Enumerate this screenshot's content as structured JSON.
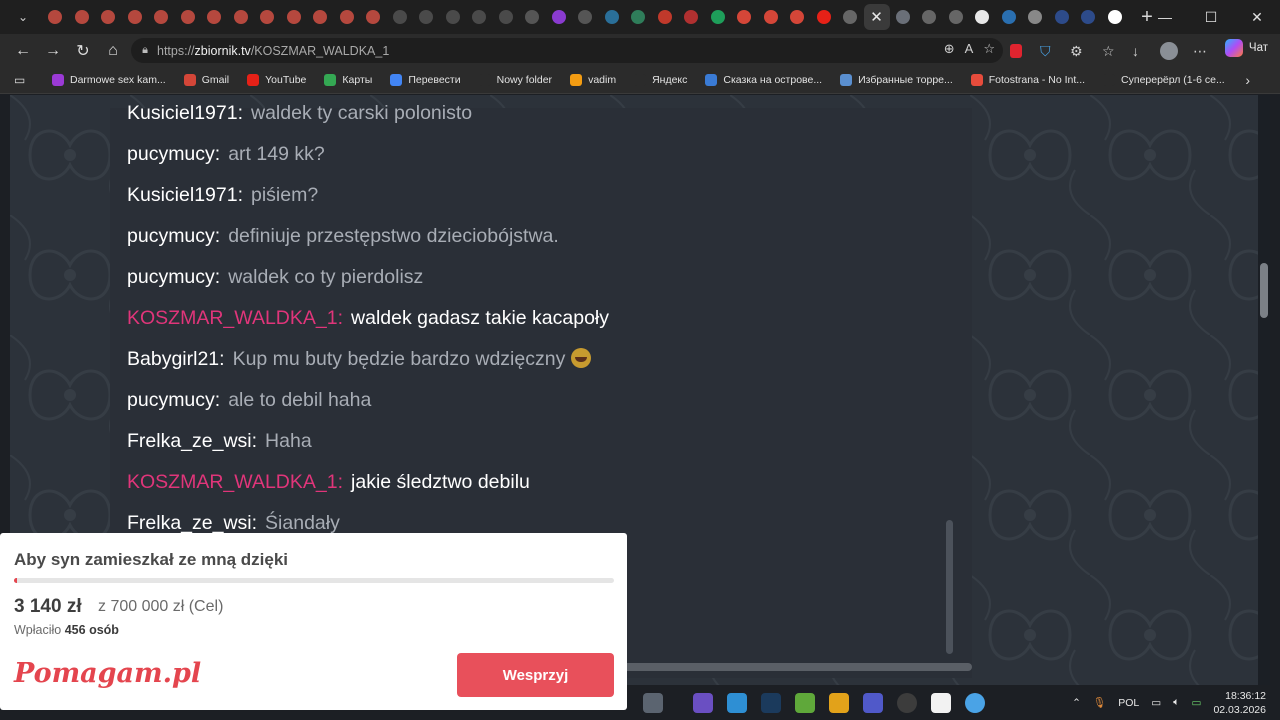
{
  "browser": {
    "tabs": [
      {
        "icon": "zbiornik-icon",
        "color": "#b5483e"
      },
      {
        "icon": "zbiornik-icon",
        "color": "#b5483e"
      },
      {
        "icon": "zbiornik-icon",
        "color": "#b5483e"
      },
      {
        "icon": "zbiornik-icon",
        "color": "#b5483e"
      },
      {
        "icon": "zbiornik-icon",
        "color": "#b5483e"
      },
      {
        "icon": "zbiornik-icon",
        "color": "#b5483e"
      },
      {
        "icon": "zbiornik-icon",
        "color": "#b5483e"
      },
      {
        "icon": "zbiornik-icon",
        "color": "#b5483e"
      },
      {
        "icon": "zbiornik-icon",
        "color": "#b5483e"
      },
      {
        "icon": "zbiornik-icon",
        "color": "#b5483e"
      },
      {
        "icon": "zbiornik-icon",
        "color": "#b5483e"
      },
      {
        "icon": "zbiornik-icon",
        "color": "#b5483e"
      },
      {
        "icon": "zbiornik-icon",
        "color": "#b5483e"
      },
      {
        "icon": "media-icon",
        "color": "#4a4a4a"
      },
      {
        "icon": "media-icon",
        "color": "#4a4a4a"
      },
      {
        "icon": "media-icon",
        "color": "#4a4a4a"
      },
      {
        "icon": "media-icon",
        "color": "#4a4a4a"
      },
      {
        "icon": "media-icon",
        "color": "#4a4a4a"
      },
      {
        "icon": "clapper-icon",
        "color": "#555"
      },
      {
        "icon": "ms-icon",
        "color": "#8a3bd0"
      },
      {
        "icon": "chart-icon",
        "color": "#555"
      },
      {
        "icon": "steam-icon",
        "color": "#2a6f99"
      },
      {
        "icon": "image-icon",
        "color": "#2f7d5a"
      },
      {
        "icon": "pin-icon",
        "color": "#c0392b"
      },
      {
        "icon": "play-icon",
        "color": "#b03030"
      },
      {
        "icon": "chat-icon",
        "color": "#1e9e5a"
      },
      {
        "icon": "gmail-icon",
        "color": "#d44638"
      },
      {
        "icon": "gmail-icon",
        "color": "#d44638"
      },
      {
        "icon": "gmail-icon",
        "color": "#d44638"
      },
      {
        "icon": "youtube-icon",
        "color": "#e62117"
      },
      {
        "icon": "globe-icon",
        "color": "#666"
      }
    ],
    "active_tab": {
      "icon": "close-icon"
    },
    "tabs_after": [
      {
        "icon": "z-icon",
        "color": "#6a6f78"
      },
      {
        "icon": "globe-icon",
        "color": "#666"
      },
      {
        "icon": "globe-icon",
        "color": "#666"
      },
      {
        "icon": "z-icon",
        "color": "#e8e8e8"
      },
      {
        "icon": "image-icon",
        "color": "#2a6fb0"
      },
      {
        "icon": "image-icon",
        "color": "#888"
      },
      {
        "icon": "dz-icon",
        "color": "#2d4b8a"
      },
      {
        "icon": "dz-icon",
        "color": "#2d4b8a"
      },
      {
        "icon": "google-icon",
        "color": "#ffffff"
      }
    ],
    "url": {
      "prefix": "https://",
      "host": "zbiornik.tv",
      "path": "/KOSZMAR_WALDKA_1"
    },
    "chat_label": "Чат",
    "bookmarks": [
      {
        "label": "Darmowe sex kam...",
        "color": "#9b3ad6"
      },
      {
        "label": "Gmail",
        "color": "#d44638"
      },
      {
        "label": "YouTube",
        "color": "#e62117"
      },
      {
        "label": "Карты",
        "color": "#34a853"
      },
      {
        "label": "Перевести",
        "color": "#4285f4"
      },
      {
        "label": "Nowy folder",
        "color": "#2b2b2b"
      },
      {
        "label": "vadim",
        "color": "#f39c12"
      },
      {
        "label": "Яндекс",
        "color": "#2b2b2b"
      },
      {
        "label": "Сказка на острове...",
        "color": "#3a7bd5"
      },
      {
        "label": "Избранные торре...",
        "color": "#5a8fd0"
      },
      {
        "label": "Fotostrana - No Int...",
        "color": "#e74c3c"
      },
      {
        "label": "Суперерёрл (1-6 се...",
        "color": "#2b2b2b"
      }
    ]
  },
  "chat": {
    "messages": [
      {
        "user": "Kusiciel1971:",
        "text": "waldek ty carski polonisto",
        "highlight": false
      },
      {
        "user": "pucymucy:",
        "text": "art 149 kk?",
        "highlight": false
      },
      {
        "user": "Kusiciel1971:",
        "text": "piśiem?",
        "highlight": false
      },
      {
        "user": "pucymucy:",
        "text": "definiuje przestępstwo dzieciobójstwa.",
        "highlight": false
      },
      {
        "user": "pucymucy:",
        "text": "waldek co ty pierdolisz",
        "highlight": false
      },
      {
        "user": "KOSZMAR_WALDKA_1:",
        "text": "waldek gadasz takie kacapoły",
        "highlight": true
      },
      {
        "user": "Babygirl21:",
        "text": "Kup mu buty będzie bardzo wdzięczny",
        "highlight": false,
        "emoji": "rofl-icon"
      },
      {
        "user": "pucymucy:",
        "text": "ale to debil haha",
        "highlight": false
      },
      {
        "user": "Frelka_ze_wsi:",
        "text": "Haha",
        "highlight": false
      },
      {
        "user": "KOSZMAR_WALDKA_1:",
        "text": "jakie śledztwo debilu",
        "highlight": true
      },
      {
        "user": "Frelka_ze_wsi:",
        "text": "Śiandały",
        "highlight": false
      }
    ]
  },
  "donation": {
    "title": "Aby syn zamieszkał ze mną dzięki",
    "amount": "3 140 zł",
    "goal": "z 700 000 zł (Cel)",
    "donors_prefix": "Wpłaciło",
    "donors_count": "456 osób",
    "progress_fraction": 0.0045,
    "logo": "Pomagam.pl",
    "button": "Wesprzyj",
    "accent": "#e4454e"
  },
  "taskbar": {
    "language": "POL",
    "time": "18:36:12",
    "date": "02.03.2026"
  }
}
